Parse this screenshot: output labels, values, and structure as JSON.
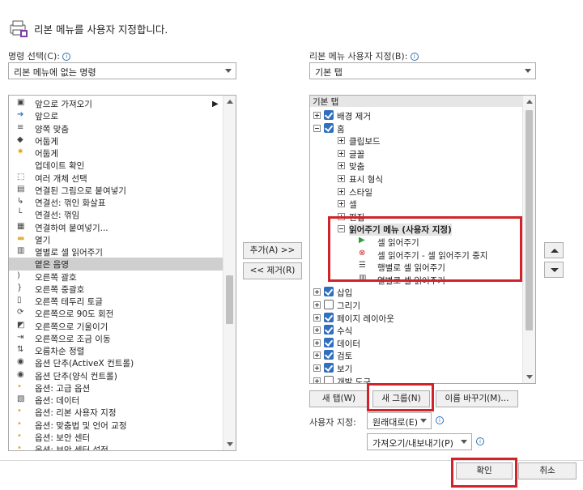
{
  "header": {
    "title": "리본 메뉴를 사용자 지정합니다."
  },
  "left": {
    "label": "명령 선택(C):",
    "dropdown_value": "리본 메뉴에 없는 명령",
    "commands": [
      {
        "label": "앞으로 가져오기",
        "icon": "bring-forward-icon"
      },
      {
        "label": "앞으로",
        "icon": "forward-arrow-icon"
      },
      {
        "label": "양쪽 맞춤",
        "icon": "justify-icon"
      },
      {
        "label": "어둡게",
        "icon": "darker-icon"
      },
      {
        "label": "어둡게",
        "icon": "darker-sun-icon"
      },
      {
        "label": "업데이트 확인",
        "icon": ""
      },
      {
        "label": "여러 개체 선택",
        "icon": "select-objects-icon"
      },
      {
        "label": "연결된 그림으로 붙여넣기",
        "icon": "paste-picture-link-icon"
      },
      {
        "label": "연결선: 꺾인 화살표",
        "icon": "elbow-arrow-connector-icon"
      },
      {
        "label": "연결선: 꺾임",
        "icon": "elbow-connector-icon"
      },
      {
        "label": "연결하여 붙여넣기...",
        "icon": "paste-link-icon"
      },
      {
        "label": "열기",
        "icon": "open-folder-icon"
      },
      {
        "label": "열별로 셀 읽어주기",
        "icon": "speak-by-columns-icon"
      },
      {
        "label": "옅은 음영",
        "icon": "",
        "selected": true
      },
      {
        "label": "오른쪽 괄호",
        "icon": "right-paren-icon"
      },
      {
        "label": "오른쪽 중괄호",
        "icon": "right-brace-icon"
      },
      {
        "label": "오른쪽 테두리 토글",
        "icon": "right-border-icon"
      },
      {
        "label": "오른쪽으로 90도 회전",
        "icon": "rotate-right-icon"
      },
      {
        "label": "오른쪽으로 기울이기",
        "icon": "tilt-right-icon"
      },
      {
        "label": "오른쪽으로 조금 이동",
        "icon": "nudge-right-icon"
      },
      {
        "label": "오름차순 정렬",
        "icon": "sort-ascending-icon"
      },
      {
        "label": "옵션 단추(ActiveX 컨트롤)",
        "icon": "radio-activex-icon"
      },
      {
        "label": "옵션 단추(양식 컨트롤)",
        "icon": "radio-form-icon"
      },
      {
        "label": "옵션: 고급 옵션",
        "icon": "bullet-dot-icon"
      },
      {
        "label": "옵션: 데이터",
        "icon": "options-data-icon"
      },
      {
        "label": "옵션: 리본 사용자 지정",
        "icon": "bullet-dot-icon"
      },
      {
        "label": "옵션: 맞춤법 및 언어 교정",
        "icon": "bullet-dot-icon"
      },
      {
        "label": "옵션: 보안 센터",
        "icon": "bullet-dot-icon"
      },
      {
        "label": "옵션: 보안 센터 설정",
        "icon": "bullet-dot-icon"
      }
    ]
  },
  "middle": {
    "add_label": "추가(A) >>",
    "remove_label": "<< 제거(R)"
  },
  "right": {
    "label": "리본 메뉴 사용자 지정(B):",
    "dropdown_value": "기본 탭",
    "tree_header": "기본 탭",
    "tree": [
      {
        "label": "배경 제거",
        "level": 0,
        "exp": "plus",
        "chk": true
      },
      {
        "label": "홈",
        "level": 0,
        "exp": "minus",
        "chk": true
      },
      {
        "label": "클립보드",
        "level": 1,
        "exp": "plus"
      },
      {
        "label": "글꼴",
        "level": 1,
        "exp": "plus"
      },
      {
        "label": "맞춤",
        "level": 1,
        "exp": "plus"
      },
      {
        "label": "표시 형식",
        "level": 1,
        "exp": "plus"
      },
      {
        "label": "스타일",
        "level": 1,
        "exp": "plus"
      },
      {
        "label": "셀",
        "level": 1,
        "exp": "plus"
      },
      {
        "label": "편집",
        "level": 1,
        "exp": "plus"
      },
      {
        "label": "읽어주기 메뉴 (사용자 지정)",
        "level": 1,
        "exp": "minus",
        "bold": true
      },
      {
        "label": "셀 읽어주기",
        "level": 2,
        "icon": "speak-cells-icon"
      },
      {
        "label": "셀 읽어주기 - 셀 읽어주기 중지",
        "level": 2,
        "icon": "stop-speaking-icon"
      },
      {
        "label": "행별로 셀 읽어주기",
        "level": 2,
        "icon": "speak-by-rows-icon"
      },
      {
        "label": "열별로 셀 읽어주기",
        "level": 2,
        "icon": "speak-by-columns-icon"
      },
      {
        "label": "삽입",
        "level": 0,
        "exp": "plus",
        "chk": true
      },
      {
        "label": "그리기",
        "level": 0,
        "exp": "plus",
        "chk": false
      },
      {
        "label": "페이지 레이아웃",
        "level": 0,
        "exp": "plus",
        "chk": true
      },
      {
        "label": "수식",
        "level": 0,
        "exp": "plus",
        "chk": true
      },
      {
        "label": "데이터",
        "level": 0,
        "exp": "plus",
        "chk": true
      },
      {
        "label": "검토",
        "level": 0,
        "exp": "plus",
        "chk": true
      },
      {
        "label": "보기",
        "level": 0,
        "exp": "plus",
        "chk": true
      },
      {
        "label": "개발 도구",
        "level": 0,
        "exp": "plus",
        "chk": false
      }
    ],
    "new_tab_label": "새 탭(W)",
    "new_group_label": "새 그룹(N)",
    "rename_label": "이름 바꾸기(M)...",
    "custom_label": "사용자 지정:",
    "reset_label": "원래대로(E)",
    "import_export_label": "가져오기/내보내기(P)"
  },
  "footer": {
    "ok_label": "확인",
    "cancel_label": "취소"
  },
  "colors": {
    "highlight": "#d2232a",
    "check": "#2f6fbd",
    "info": "#2e75b6"
  }
}
